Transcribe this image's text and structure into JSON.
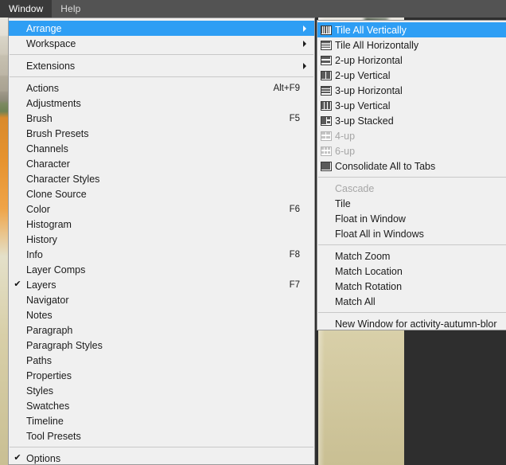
{
  "menubar": {
    "items": [
      {
        "label": "Window",
        "active": true
      },
      {
        "label": "Help",
        "active": false
      }
    ]
  },
  "window_menu": {
    "groups": [
      {
        "items": [
          {
            "label": "Arrange",
            "shortcut": "",
            "checked": false,
            "submenu": true,
            "selected": true,
            "disabled": false
          },
          {
            "label": "Workspace",
            "shortcut": "",
            "checked": false,
            "submenu": true,
            "selected": false,
            "disabled": false
          }
        ]
      },
      {
        "items": [
          {
            "label": "Extensions",
            "shortcut": "",
            "checked": false,
            "submenu": true,
            "selected": false,
            "disabled": false
          }
        ]
      },
      {
        "items": [
          {
            "label": "Actions",
            "shortcut": "Alt+F9",
            "checked": false,
            "submenu": false,
            "selected": false,
            "disabled": false
          },
          {
            "label": "Adjustments",
            "shortcut": "",
            "checked": false,
            "submenu": false,
            "selected": false,
            "disabled": false
          },
          {
            "label": "Brush",
            "shortcut": "F5",
            "checked": false,
            "submenu": false,
            "selected": false,
            "disabled": false
          },
          {
            "label": "Brush Presets",
            "shortcut": "",
            "checked": false,
            "submenu": false,
            "selected": false,
            "disabled": false
          },
          {
            "label": "Channels",
            "shortcut": "",
            "checked": false,
            "submenu": false,
            "selected": false,
            "disabled": false
          },
          {
            "label": "Character",
            "shortcut": "",
            "checked": false,
            "submenu": false,
            "selected": false,
            "disabled": false
          },
          {
            "label": "Character Styles",
            "shortcut": "",
            "checked": false,
            "submenu": false,
            "selected": false,
            "disabled": false
          },
          {
            "label": "Clone Source",
            "shortcut": "",
            "checked": false,
            "submenu": false,
            "selected": false,
            "disabled": false
          },
          {
            "label": "Color",
            "shortcut": "F6",
            "checked": false,
            "submenu": false,
            "selected": false,
            "disabled": false
          },
          {
            "label": "Histogram",
            "shortcut": "",
            "checked": false,
            "submenu": false,
            "selected": false,
            "disabled": false
          },
          {
            "label": "History",
            "shortcut": "",
            "checked": false,
            "submenu": false,
            "selected": false,
            "disabled": false
          },
          {
            "label": "Info",
            "shortcut": "F8",
            "checked": false,
            "submenu": false,
            "selected": false,
            "disabled": false
          },
          {
            "label": "Layer Comps",
            "shortcut": "",
            "checked": false,
            "submenu": false,
            "selected": false,
            "disabled": false
          },
          {
            "label": "Layers",
            "shortcut": "F7",
            "checked": true,
            "submenu": false,
            "selected": false,
            "disabled": false
          },
          {
            "label": "Navigator",
            "shortcut": "",
            "checked": false,
            "submenu": false,
            "selected": false,
            "disabled": false
          },
          {
            "label": "Notes",
            "shortcut": "",
            "checked": false,
            "submenu": false,
            "selected": false,
            "disabled": false
          },
          {
            "label": "Paragraph",
            "shortcut": "",
            "checked": false,
            "submenu": false,
            "selected": false,
            "disabled": false
          },
          {
            "label": "Paragraph Styles",
            "shortcut": "",
            "checked": false,
            "submenu": false,
            "selected": false,
            "disabled": false
          },
          {
            "label": "Paths",
            "shortcut": "",
            "checked": false,
            "submenu": false,
            "selected": false,
            "disabled": false
          },
          {
            "label": "Properties",
            "shortcut": "",
            "checked": false,
            "submenu": false,
            "selected": false,
            "disabled": false
          },
          {
            "label": "Styles",
            "shortcut": "",
            "checked": false,
            "submenu": false,
            "selected": false,
            "disabled": false
          },
          {
            "label": "Swatches",
            "shortcut": "",
            "checked": false,
            "submenu": false,
            "selected": false,
            "disabled": false
          },
          {
            "label": "Timeline",
            "shortcut": "",
            "checked": false,
            "submenu": false,
            "selected": false,
            "disabled": false
          },
          {
            "label": "Tool Presets",
            "shortcut": "",
            "checked": false,
            "submenu": false,
            "selected": false,
            "disabled": false
          }
        ]
      },
      {
        "items": [
          {
            "label": "Options",
            "shortcut": "",
            "checked": true,
            "submenu": false,
            "selected": false,
            "disabled": false
          }
        ]
      }
    ]
  },
  "arrange_submenu": {
    "groups": [
      {
        "items": [
          {
            "label": "Tile All Vertically",
            "icon": "tile-all-vertically-icon",
            "selected": true,
            "disabled": false
          },
          {
            "label": "Tile All Horizontally",
            "icon": "tile-all-horizontally-icon",
            "selected": false,
            "disabled": false
          },
          {
            "label": "2-up Horizontal",
            "icon": "two-up-horizontal-icon",
            "selected": false,
            "disabled": false
          },
          {
            "label": "2-up Vertical",
            "icon": "two-up-vertical-icon",
            "selected": false,
            "disabled": false
          },
          {
            "label": "3-up Horizontal",
            "icon": "three-up-horizontal-icon",
            "selected": false,
            "disabled": false
          },
          {
            "label": "3-up Vertical",
            "icon": "three-up-vertical-icon",
            "selected": false,
            "disabled": false
          },
          {
            "label": "3-up Stacked",
            "icon": "three-up-stacked-icon",
            "selected": false,
            "disabled": false
          },
          {
            "label": "4-up",
            "icon": "four-up-icon",
            "selected": false,
            "disabled": true
          },
          {
            "label": "6-up",
            "icon": "six-up-icon",
            "selected": false,
            "disabled": true
          },
          {
            "label": "Consolidate All to Tabs",
            "icon": "consolidate-all-to-tabs-icon",
            "selected": false,
            "disabled": false
          }
        ]
      },
      {
        "items": [
          {
            "label": "Cascade",
            "icon": "",
            "selected": false,
            "disabled": true
          },
          {
            "label": "Tile",
            "icon": "",
            "selected": false,
            "disabled": false
          },
          {
            "label": "Float in Window",
            "icon": "",
            "selected": false,
            "disabled": false
          },
          {
            "label": "Float All in Windows",
            "icon": "",
            "selected": false,
            "disabled": false
          }
        ]
      },
      {
        "items": [
          {
            "label": "Match Zoom",
            "icon": "",
            "selected": false,
            "disabled": false
          },
          {
            "label": "Match Location",
            "icon": "",
            "selected": false,
            "disabled": false
          },
          {
            "label": "Match Rotation",
            "icon": "",
            "selected": false,
            "disabled": false
          },
          {
            "label": "Match All",
            "icon": "",
            "selected": false,
            "disabled": false
          }
        ]
      },
      {
        "items": [
          {
            "label": "New Window for activity-autumn-blor",
            "icon": "",
            "selected": false,
            "disabled": false
          }
        ]
      }
    ]
  },
  "check_glyph": "✔",
  "colors": {
    "menubar_bg": "#535353",
    "menubar_active_bg": "#3a3a3a",
    "menu_bg": "#f0f0f0",
    "menu_border": "#9a9a9a",
    "highlight": "#2e9ef4",
    "text": "#1b1b1b",
    "disabled_text": "#a6a6a6",
    "canvas_bg": "#2e2e2e"
  }
}
